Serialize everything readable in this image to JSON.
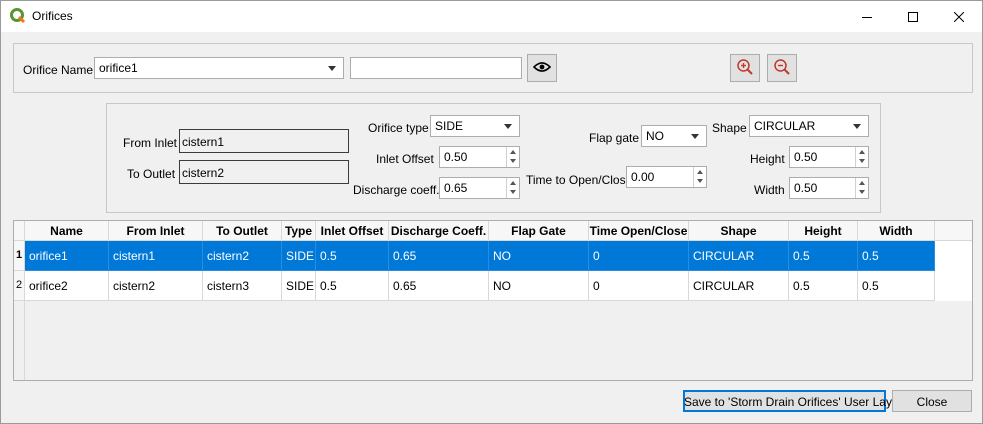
{
  "window": {
    "title": "Orifices"
  },
  "top": {
    "orifice_name_label": "Orifice Name:",
    "orifice_name_value": "orifice1",
    "search_value": ""
  },
  "params": {
    "from_inlet_label": "From Inlet",
    "from_inlet_value": "cistern1",
    "to_outlet_label": "To Outlet",
    "to_outlet_value": "cistern2",
    "orifice_type_label": "Orifice type",
    "orifice_type_value": "SIDE",
    "inlet_offset_label": "Inlet Offset",
    "inlet_offset_value": "0.50",
    "discharge_label": "Discharge coeff.",
    "discharge_value": "0.65",
    "flap_gate_label": "Flap gate",
    "flap_gate_value": "NO",
    "time_label": "Time to Open/Close",
    "time_value": "0.00",
    "shape_label": "Shape",
    "shape_value": "CIRCULAR",
    "height_label": "Height",
    "height_value": "0.50",
    "width_label": "Width",
    "width_value": "0.50"
  },
  "table": {
    "columns": [
      "Name",
      "From Inlet",
      "To Outlet",
      "Type",
      "Inlet Offset",
      "Discharge Coeff.",
      "Flap Gate",
      "Time Open/Close",
      "Shape",
      "Height",
      "Width"
    ],
    "rows": [
      {
        "num": "1",
        "cells": [
          "orifice1",
          "cistern1",
          "cistern2",
          "SIDE",
          "0.5",
          "0.65",
          "NO",
          "0",
          "CIRCULAR",
          "0.5",
          "0.5"
        ]
      },
      {
        "num": "2",
        "cells": [
          "orifice2",
          "cistern2",
          "cistern3",
          "SIDE",
          "0.5",
          "0.65",
          "NO",
          "0",
          "CIRCULAR",
          "0.5",
          "0.5"
        ]
      }
    ],
    "selected_row": 0
  },
  "footer": {
    "save_label": "Save to 'Storm Drain Orifices' User Layer",
    "close_label": "Close"
  },
  "colors": {
    "selection": "#0078d7",
    "app_icon": "#589632"
  },
  "icons": [
    "qgis-icon",
    "minimize-icon",
    "maximize-icon",
    "close-icon",
    "eye-icon",
    "zoom-in-icon",
    "zoom-out-icon"
  ]
}
